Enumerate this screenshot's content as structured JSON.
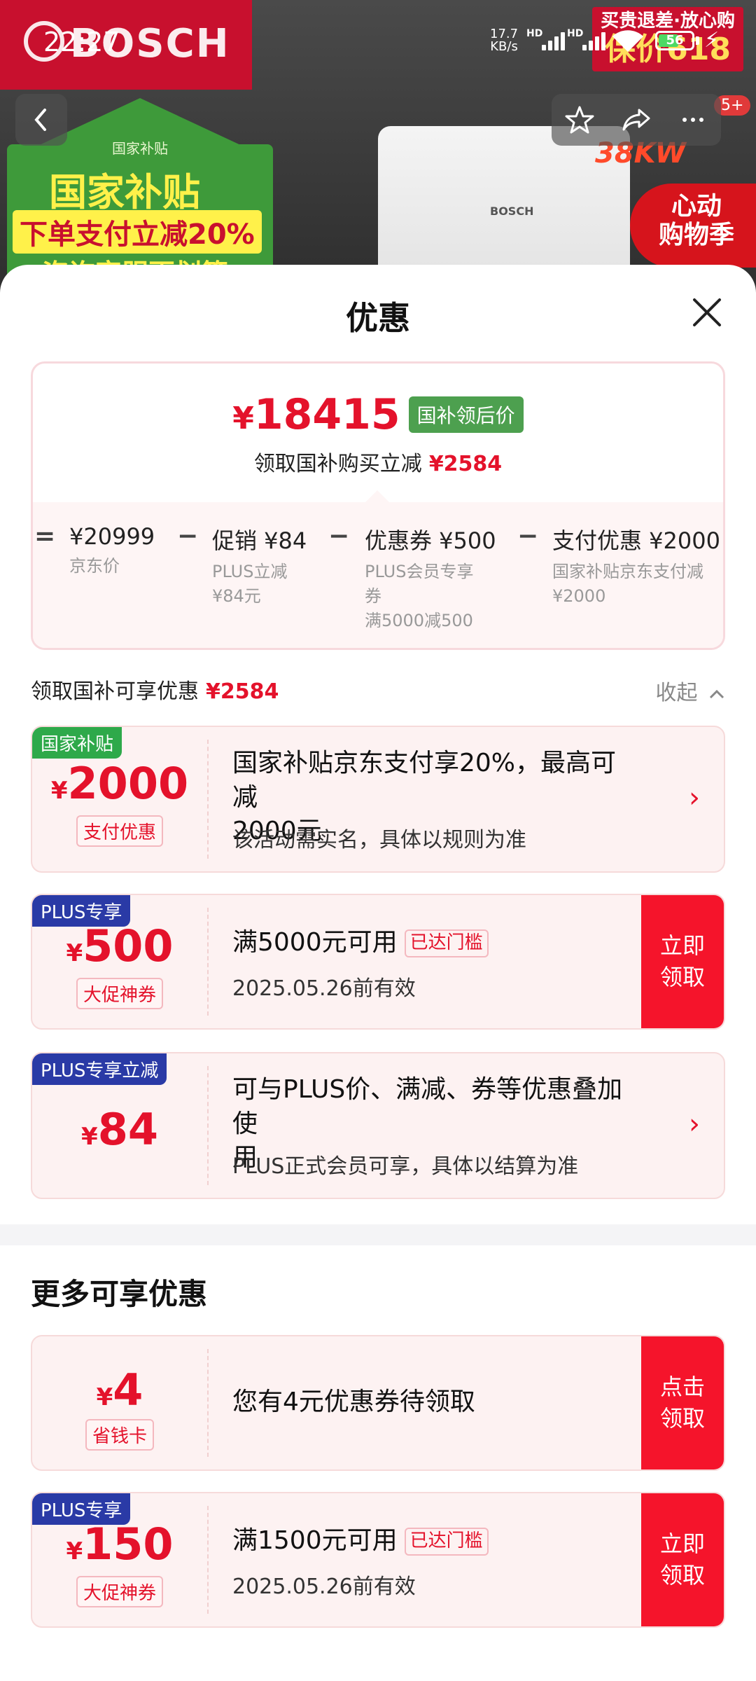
{
  "status_bar": {
    "time": "22:27",
    "net_speed_value": "17.7",
    "net_speed_unit": "KB/s",
    "hd1": "HD",
    "hd2": "HD",
    "battery": "56"
  },
  "background": {
    "brand": "BOSCH",
    "house_small": "国家补贴",
    "house_title": "国家补贴",
    "house_sub": "下单支付立减20%",
    "house_sub2": "咨询客服更划算",
    "promo_line1": "买贵退差·放心购",
    "promo_line2": "保价618",
    "boiler_logo": "BOSCH",
    "kw_text": "38KW",
    "heart_line1": "心动",
    "heart_line2": "购物季",
    "badge": "5+",
    "icons": [
      "back-icon",
      "star-icon",
      "share-icon",
      "more-icon"
    ]
  },
  "sheet": {
    "title": "优惠",
    "summary": {
      "final_price_symbol": "¥",
      "final_price": "18415",
      "final_tag": "国补领后价",
      "reduce_text": "领取国补购买立减",
      "reduce_amount": "¥2584",
      "breakdown": [
        {
          "op": "=",
          "title": "¥20999",
          "sub1": "京东价",
          "sub2": "",
          "sub3": ""
        },
        {
          "op": "−",
          "title": "促销 ¥84",
          "sub1": "PLUS立减",
          "sub2": "¥84元",
          "sub3": ""
        },
        {
          "op": "−",
          "title": "优惠券 ¥500",
          "sub1": "PLUS会员专享",
          "sub2": "券",
          "sub3": "满5000减500"
        },
        {
          "op": "−",
          "title": "支付优惠 ¥2000",
          "sub1": "国家补贴京东支付减",
          "sub2": "¥2000",
          "sub3": ""
        }
      ]
    },
    "available": {
      "label": "领取国补可享优惠",
      "amount": "¥2584",
      "collapse": "收起"
    },
    "coupons": [
      {
        "tag": "国家补贴",
        "symbol": "¥",
        "amount": "2000",
        "type": "支付优惠",
        "title_line1": "国家补贴京东支付享20%，最高可减",
        "title_line2": "2000元",
        "desc": "该活动需实名，具体以规则为准"
      },
      {
        "tag": "PLUS专享",
        "symbol": "¥",
        "amount": "500",
        "type": "大促神券",
        "title": "满5000元可用",
        "reach": "已达门槛",
        "desc": "2025.05.26前有效",
        "button_line1": "立即",
        "button_line2": "领取"
      },
      {
        "tag": "PLUS专享立减",
        "symbol": "¥",
        "amount": "84",
        "title_line1": "可与PLUS价、满减、券等优惠叠加使",
        "title_line2": "用",
        "desc": "PLUS正式会员可享，具体以结算为准"
      }
    ],
    "more_title": "更多可享优惠",
    "more_coupons": [
      {
        "symbol": "¥",
        "amount": "4",
        "type": "省钱卡",
        "title": "您有4元优惠券待领取",
        "button_line1": "点击",
        "button_line2": "领取"
      },
      {
        "tag": "PLUS专享",
        "symbol": "¥",
        "amount": "150",
        "type": "大促神券",
        "title": "满1500元可用",
        "reach": "已达门槛",
        "desc": "2025.05.26前有效",
        "button_line1": "立即",
        "button_line2": "领取"
      }
    ]
  }
}
